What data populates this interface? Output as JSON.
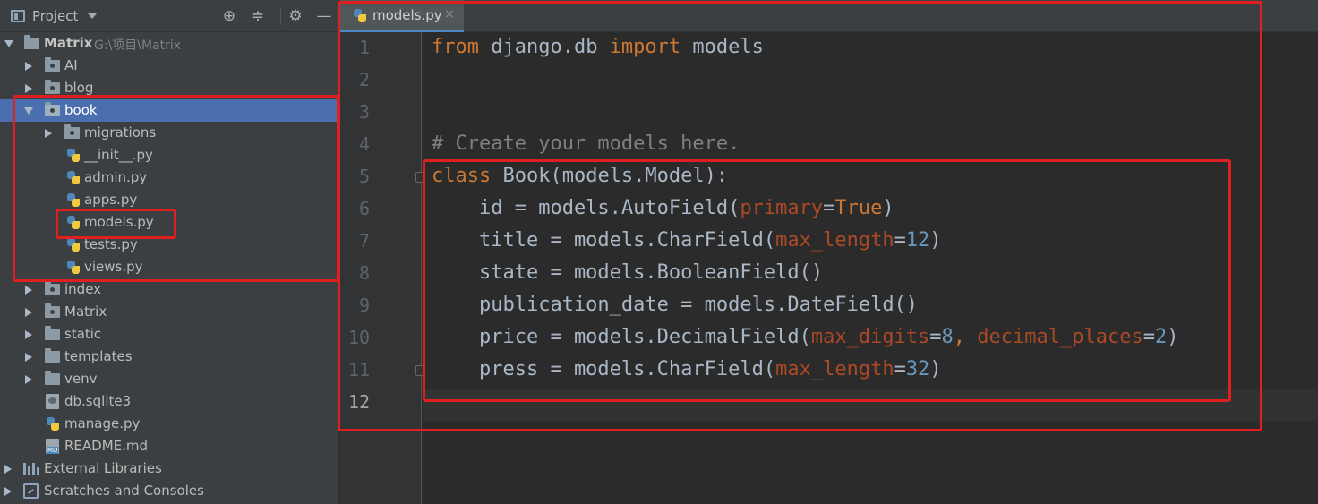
{
  "sidebar": {
    "header": {
      "title": "Project"
    },
    "tree": [
      {
        "label": "Matrix",
        "sub": "G:\\项目\\Matrix"
      },
      {
        "label": "AI"
      },
      {
        "label": "blog"
      },
      {
        "label": "book"
      },
      {
        "label": "migrations"
      },
      {
        "label": "__init__.py"
      },
      {
        "label": "admin.py"
      },
      {
        "label": "apps.py"
      },
      {
        "label": "models.py"
      },
      {
        "label": "tests.py"
      },
      {
        "label": "views.py"
      },
      {
        "label": "index"
      },
      {
        "label": "Matrix"
      },
      {
        "label": "static"
      },
      {
        "label": "templates"
      },
      {
        "label": "venv"
      },
      {
        "label": "db.sqlite3"
      },
      {
        "label": "manage.py"
      },
      {
        "label": "README.md"
      },
      {
        "label": "External Libraries"
      },
      {
        "label": "Scratches and Consoles"
      }
    ]
  },
  "editor": {
    "tab": {
      "label": "models.py",
      "close": "×"
    },
    "line_numbers": [
      "1",
      "2",
      "3",
      "4",
      "5",
      "6",
      "7",
      "8",
      "9",
      "10",
      "11",
      "12"
    ],
    "lines": [
      {
        "kw1": "from",
        "mod": " django.db ",
        "kw2": "import",
        "rest": " models"
      },
      {
        "text": ""
      },
      {
        "text": ""
      },
      {
        "comment": "# Create your models here."
      },
      {
        "kw": "class",
        "rest": " Book(models.Model):"
      },
      {
        "pre": "    id = models.AutoField(",
        "p1": "primary",
        "eq1": "=",
        "v1": "True",
        "post": ")"
      },
      {
        "pre": "    title = models.CharField(",
        "p1": "max_length",
        "eq1": "=",
        "v1": "12",
        "post": ")"
      },
      {
        "text": "    state = models.BooleanField()"
      },
      {
        "text": "    publication_date = models.DateField()"
      },
      {
        "pre": "    price = models.DecimalField(",
        "p1": "max_digits",
        "eq1": "=",
        "v1": "8",
        "sep": ", ",
        "p2": "decimal_places",
        "eq2": "=",
        "v2": "2",
        "post": ")"
      },
      {
        "pre": "    press = models.CharField(",
        "p1": "max_length",
        "eq1": "=",
        "v1": "32",
        "post": ")"
      },
      {
        "text": ""
      }
    ]
  },
  "colors": {
    "keyword": "#cc7832",
    "comment": "#808080",
    "param": "#aa4926",
    "number": "#6897bb",
    "annotation": "#e02020",
    "selection": "#4b6eaf"
  }
}
